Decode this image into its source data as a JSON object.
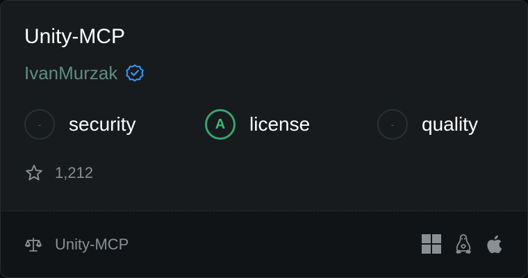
{
  "repo": {
    "name": "Unity-MCP",
    "author": "IvanMurzak",
    "verified": true,
    "stars": "1,212"
  },
  "scores": [
    {
      "grade": "-",
      "label": "security"
    },
    {
      "grade": "A",
      "label": "license"
    },
    {
      "grade": "-",
      "label": "quality"
    }
  ],
  "footer": {
    "label": "Unity-MCP",
    "platforms": [
      "windows-icon",
      "linux-icon",
      "apple-icon"
    ]
  },
  "colors": {
    "background": "#171b1d",
    "footer_background": "#111416",
    "author": "#5f8d80",
    "verified": "#3b8ef0",
    "grade_a": "#3aa46d",
    "muted_text": "#8a8f93"
  }
}
